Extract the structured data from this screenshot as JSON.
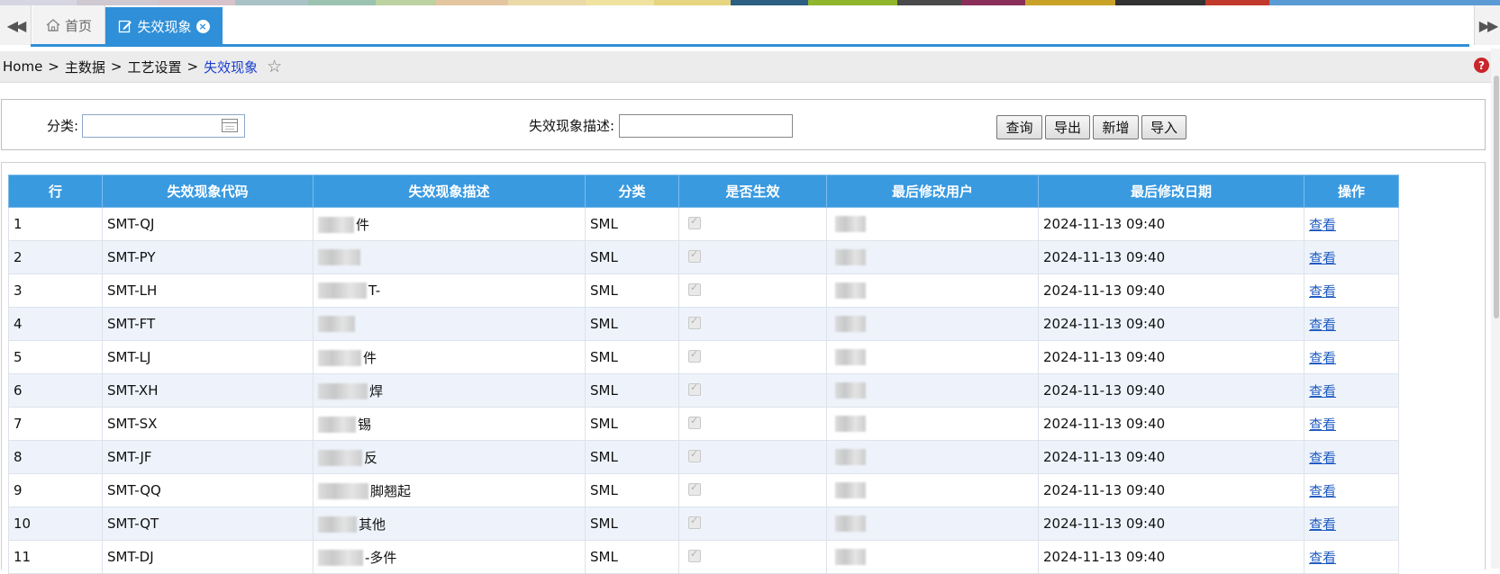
{
  "color_strip": [
    "#d6d6e2",
    "#cfc9d2",
    "#d7c3c9",
    "#a9c2c6",
    "#9cc3b0",
    "#bcd2a0",
    "#e3c6a0",
    "#ecd9a8",
    "#f0e3a0",
    "#e6d57e",
    "#2d5f82",
    "#8fb62c",
    "#4a4a4a",
    "#8b2f5a",
    "#c9a227",
    "#333333",
    "#c0392b",
    "#5b9bd5"
  ],
  "tabs": {
    "home_label": "首页",
    "active_label": "失效现象",
    "close_glyph": "×"
  },
  "breadcrumb": {
    "items": [
      "Home",
      "主数据",
      "工艺设置"
    ],
    "separator": ">",
    "current": "失效现象"
  },
  "search": {
    "category_label": "分类:",
    "category_value": "",
    "desc_label": "失效现象描述:",
    "desc_value": "",
    "buttons": {
      "query": "查询",
      "export": "导出",
      "add": "新增",
      "import": "导入"
    }
  },
  "table": {
    "columns": [
      "行",
      "失效现象代码",
      "失效现象描述",
      "分类",
      "是否生效",
      "最后修改用户",
      "最后修改日期",
      "操作"
    ],
    "rows": [
      {
        "row": "1",
        "code": "SMT-QJ",
        "desc_visible": "件",
        "category": "SML",
        "date": "2024-11-13 09:40",
        "action": "查看"
      },
      {
        "row": "2",
        "code": "SMT-PY",
        "desc_visible": "",
        "category": "SML",
        "date": "2024-11-13 09:40",
        "action": "查看"
      },
      {
        "row": "3",
        "code": "SMT-LH",
        "desc_visible": "T-",
        "category": "SML",
        "date": "2024-11-13 09:40",
        "action": "查看"
      },
      {
        "row": "4",
        "code": "SMT-FT",
        "desc_visible": "",
        "category": "SML",
        "date": "2024-11-13 09:40",
        "action": "查看"
      },
      {
        "row": "5",
        "code": "SMT-LJ",
        "desc_visible": "件",
        "category": "SML",
        "date": "2024-11-13 09:40",
        "action": "查看"
      },
      {
        "row": "6",
        "code": "SMT-XH",
        "desc_visible": "焊",
        "category": "SML",
        "date": "2024-11-13 09:40",
        "action": "查看"
      },
      {
        "row": "7",
        "code": "SMT-SX",
        "desc_visible": "锡",
        "category": "SML",
        "date": "2024-11-13 09:40",
        "action": "查看"
      },
      {
        "row": "8",
        "code": "SMT-JF",
        "desc_visible": "反",
        "category": "SML",
        "date": "2024-11-13 09:40",
        "action": "查看"
      },
      {
        "row": "9",
        "code": "SMT-QQ",
        "desc_visible": "脚翘起",
        "category": "SML",
        "date": "2024-11-13 09:40",
        "action": "查看"
      },
      {
        "row": "10",
        "code": "SMT-QT",
        "desc_visible": "其他",
        "category": "SML",
        "date": "2024-11-13 09:40",
        "action": "查看"
      },
      {
        "row": "11",
        "code": "SMT-DJ",
        "desc_visible": "-多件",
        "category": "SML",
        "date": "2024-11-13 09:40",
        "action": "查看"
      }
    ]
  }
}
